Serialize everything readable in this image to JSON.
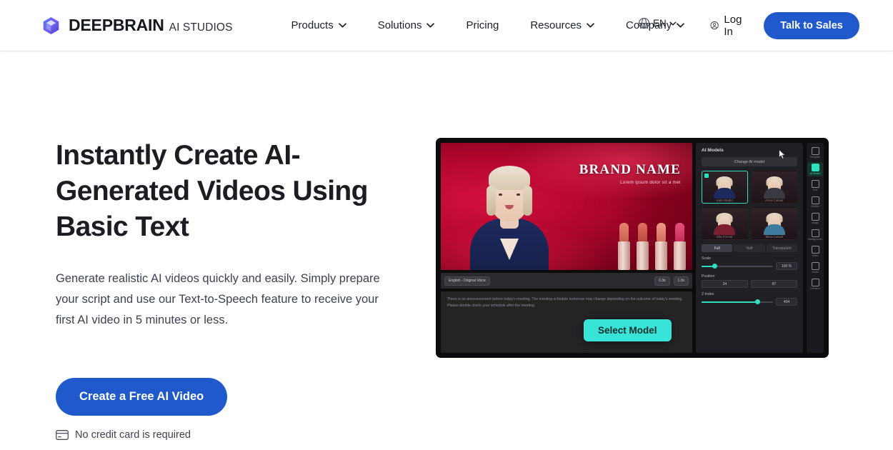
{
  "header": {
    "brand": {
      "name": "DEEPBRAIN",
      "suffix": "AI STUDIOS",
      "logo_icon": "cube-logo-icon"
    },
    "nav": [
      {
        "label": "Products",
        "has_dropdown": true
      },
      {
        "label": "Solutions",
        "has_dropdown": true
      },
      {
        "label": "Pricing",
        "has_dropdown": false
      },
      {
        "label": "Resources",
        "has_dropdown": true
      },
      {
        "label": "Company",
        "has_dropdown": true
      }
    ],
    "language": {
      "label": "EN",
      "icon": "globe-icon"
    },
    "login": {
      "label": "Log In",
      "icon": "user-circle-icon"
    },
    "cta": {
      "label": "Talk to Sales"
    },
    "accent_color": "#2059cc"
  },
  "hero": {
    "title": "Instantly Create AI-Generated Videos Using Basic Text",
    "subtitle": "Generate realistic AI videos quickly and easily. Simply prepare your script and use our Text-to-Speech feature to receive your first AI video in 5 minutes or less.",
    "cta_label": "Create a Free AI Video",
    "note": {
      "label": "No credit card is required",
      "icon": "credit-card-icon"
    }
  },
  "product_shot": {
    "canvas": {
      "brand_name": "BRAND NAME",
      "brand_tagline": "Lorem ipsum dolor sit a met"
    },
    "toolbar": {
      "voice_label": "English - Original Voice",
      "duration_label": "0.3s",
      "total_label": "1.0s"
    },
    "script_text": "There is an announcement before today's meeting. The meeting schedule tomorrow may change depending on the outcome of today's meeting. Please double check your schedule after the meeting.",
    "panel": {
      "title": "AI Models",
      "change_button": "Change AI model",
      "models": [
        {
          "name": "Kate Studio",
          "selected": true
        },
        {
          "name": "Anna Casual",
          "selected": false
        },
        {
          "name": "Ella Formal",
          "selected": false
        },
        {
          "name": "Mina Casual",
          "selected": false
        }
      ],
      "tabs": [
        {
          "label": "Full",
          "active": true
        },
        {
          "label": "Half",
          "active": false
        },
        {
          "label": "Transparent",
          "active": false
        }
      ],
      "controls": [
        {
          "label": "Scale",
          "value": "100 %",
          "fill_pct": 18
        },
        {
          "label": "Position",
          "value_x": "24",
          "value_y": "87"
        },
        {
          "label": "Z-index",
          "value": "404",
          "fill_pct": 78
        }
      ]
    },
    "rail": [
      {
        "label": "Template",
        "active": false
      },
      {
        "label": "AI Model",
        "active": true
      },
      {
        "label": "Text",
        "active": false
      },
      {
        "label": "Subtitle",
        "active": false
      },
      {
        "label": "Image",
        "active": false
      },
      {
        "label": "Background",
        "active": false
      },
      {
        "label": "Video",
        "active": false
      },
      {
        "label": "Audio",
        "active": false
      },
      {
        "label": "Element",
        "active": false
      }
    ],
    "select_model_label": "Select Model"
  }
}
